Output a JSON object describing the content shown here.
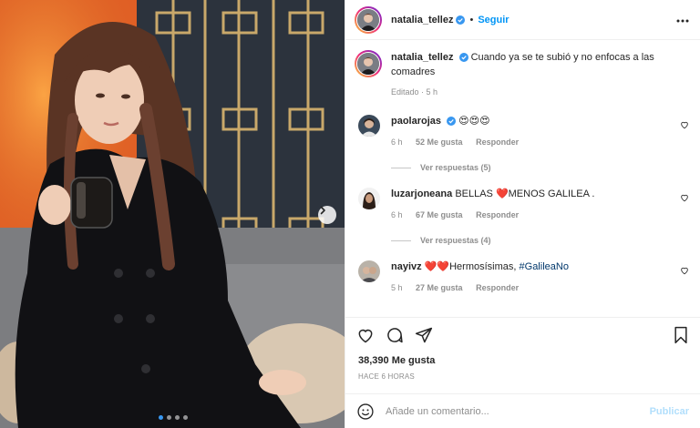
{
  "post": {
    "author": "natalia_tellez",
    "follow_label": "Seguir",
    "separator": "•",
    "caption": "Cuando ya se te subió y no enfocas a las comadres",
    "edited": "Editado · 5 h",
    "likes": "38,390 Me gusta",
    "time_ago": "HACE 6 HORAS",
    "carousel": {
      "count": 4,
      "active": 1
    }
  },
  "comments": [
    {
      "username": "paolarojas",
      "verified": true,
      "text": "",
      "emoji": "😍😍😍",
      "time": "6 h",
      "likes": "52 Me gusta",
      "reply": "Responder",
      "replies": "Ver respuestas (5)",
      "avatar_color": "#3b4a5a"
    },
    {
      "username": "luzarjoneana",
      "verified": false,
      "text": "BELLAS ❤️MENOS GALILEA .",
      "time": "6 h",
      "likes": "67 Me gusta",
      "reply": "Responder",
      "replies": "Ver respuestas (4)",
      "avatar_color": "#4a3a32"
    },
    {
      "username": "nayivz",
      "verified": false,
      "text": "❤️❤️Hermosísimas,",
      "hashtag": "#GalileaNo",
      "time": "5 h",
      "likes": "27 Me gusta",
      "reply": "Responder",
      "replies": "",
      "avatar_color": "#9a8f82"
    }
  ],
  "composer": {
    "placeholder": "Añade un comentario...",
    "publish_label": "Publicar"
  },
  "colors": {
    "accent": "#0095f6",
    "verified": "#3897f0",
    "muted": "#8e8e8e",
    "like_red": "#ed4956"
  },
  "icons": [
    "heart-icon",
    "comment-icon",
    "share-icon",
    "bookmark-icon",
    "emoji-icon",
    "more-icon",
    "chevron-right-icon",
    "verified-icon"
  ]
}
